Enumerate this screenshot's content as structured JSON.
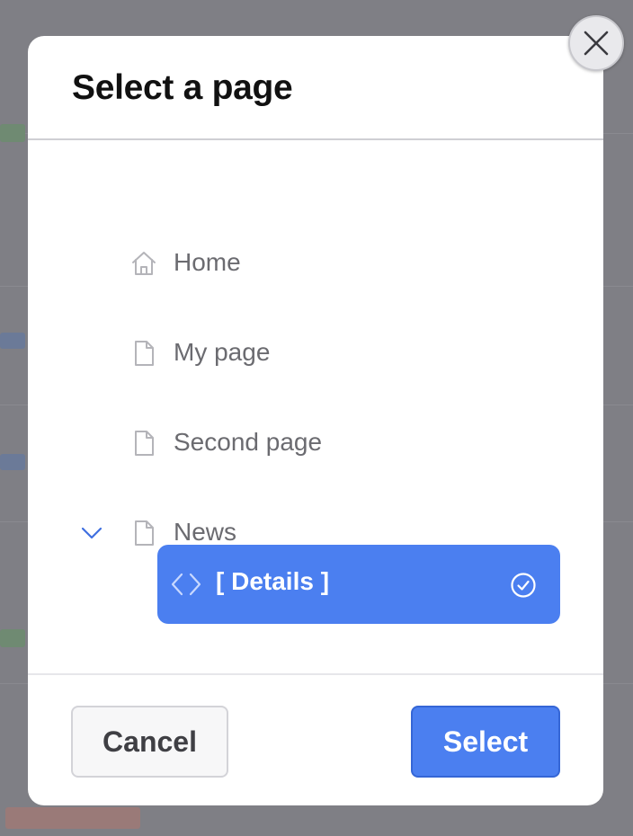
{
  "modal": {
    "title": "Select a page"
  },
  "tree": {
    "items": [
      {
        "label": "Home",
        "icon": "home-icon"
      },
      {
        "label": "My page",
        "icon": "page-icon"
      },
      {
        "label": "Second page",
        "icon": "page-icon"
      },
      {
        "label": "News",
        "icon": "page-icon",
        "expanded": true
      }
    ],
    "selected": {
      "label": "[ Details ]",
      "icon": "code-icon",
      "status_icon": "check-circle-icon"
    }
  },
  "footer": {
    "cancel_label": "Cancel",
    "select_label": "Select"
  },
  "colors": {
    "accent": "#4b7ff0",
    "overlay": "#7f7f85",
    "chevron": "#3f6fe0"
  }
}
